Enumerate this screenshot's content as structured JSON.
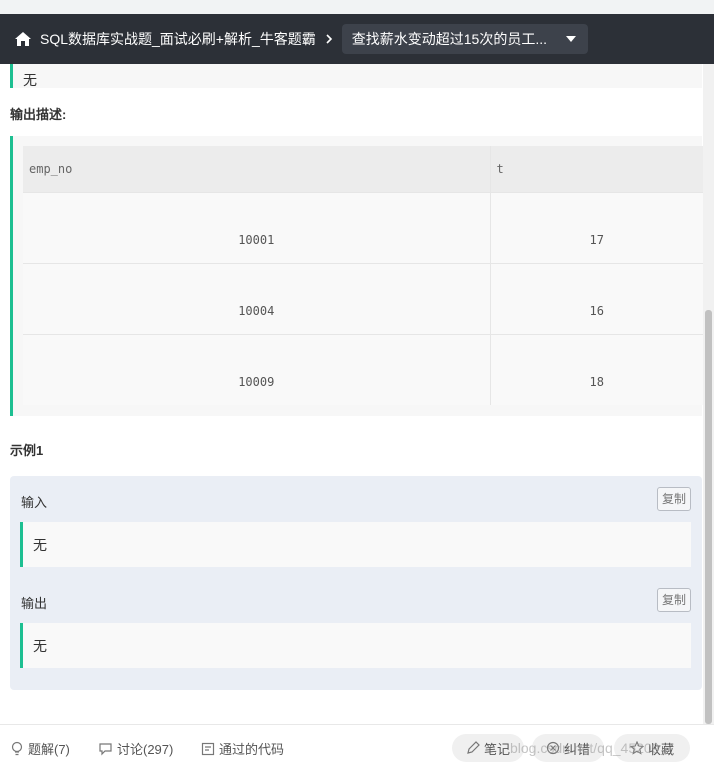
{
  "colors": {
    "accent": "#1dbf91",
    "topbar_bg": "#2c3037",
    "select_bg": "#3d424b",
    "panel_bg": "#eaeef5"
  },
  "breadcrumb": {
    "home_icon": "home-icon",
    "course": "SQL数据库实战题_面试必刷+解析_牛客题霸",
    "separator_icon": "chevron-right-icon",
    "question": "查找薪水变动超过15次的员工..."
  },
  "previous_value": "无",
  "output_section": {
    "label": "输出描述:",
    "columns": [
      "emp_no",
      "t"
    ],
    "rows": [
      [
        "10001",
        "17"
      ],
      [
        "10004",
        "16"
      ],
      [
        "10009",
        "18"
      ]
    ]
  },
  "example": {
    "title": "示例1",
    "input_label": "输入",
    "input_value": "无",
    "output_label": "输出",
    "output_value": "无",
    "copy_label": "复制"
  },
  "bottom_bar": {
    "solutions": "题解(7)",
    "discussion": "讨论(297)",
    "passed_code": "通过的代码",
    "notes": "笔记",
    "report": "纠错",
    "favorite": "收藏"
  },
  "watermark": "blog.csdn.net/qq_45209"
}
